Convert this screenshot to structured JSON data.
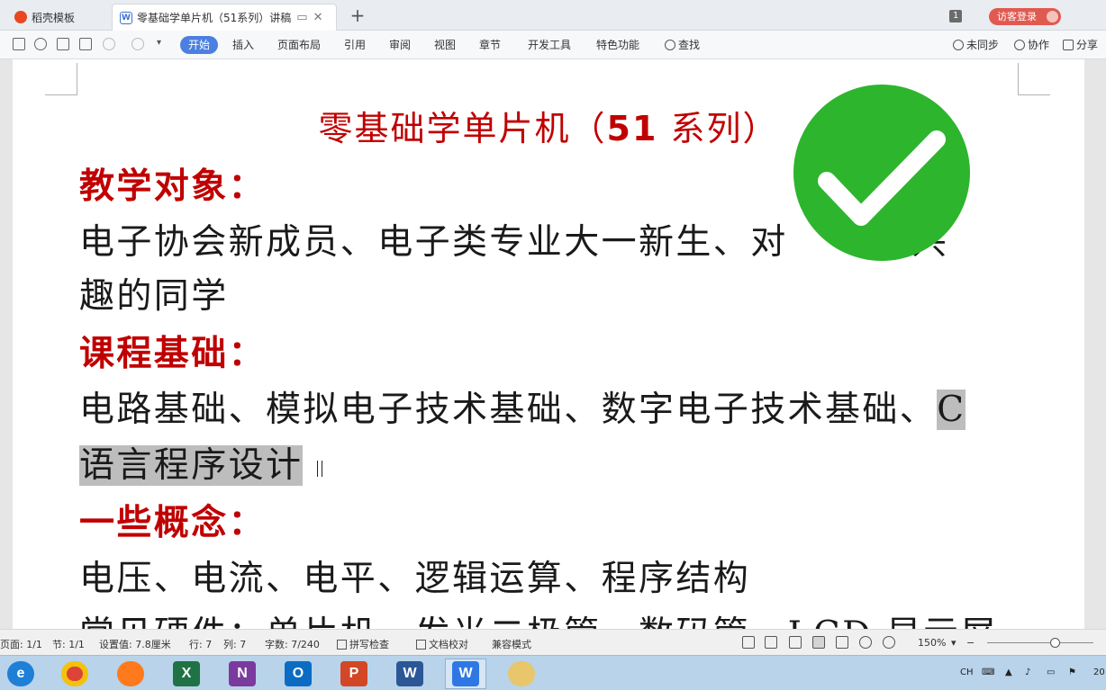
{
  "tabs": {
    "home_label": "稻壳模板",
    "doc_label": "零基础学单片机（51系列）讲稿",
    "new_tab": "+"
  },
  "header": {
    "page_count": "1",
    "login_label": "访客登录"
  },
  "ribbon": {
    "menu": [
      "开始",
      "插入",
      "页面布局",
      "引用",
      "审阅",
      "视图",
      "章节",
      "开发工具",
      "特色功能"
    ],
    "search_label": "查找",
    "sync_label": "未同步",
    "collab_label": "协作",
    "share_label": "分享"
  },
  "document": {
    "title_prefix": "零基础学单片机（",
    "title_number": "51",
    "title_suffix": " 系列）",
    "heading_1": "教学对象：",
    "body_1_line1": "电子协会新成员、电子类专业大一新生、对",
    "body_1_line1_tail": "感兴",
    "body_1_line2": "趣的同学",
    "heading_2": "课程基础：",
    "body_2_line1": "电路基础、模拟电子技术基础、数字电子技术基础、",
    "body_2_line1_sel": "C",
    "body_2_line2_sel": "语言程序设计",
    "heading_3": "一些概念：",
    "body_3": "电压、电流、电平、逻辑运算、程序结构",
    "body_4_partial": "常见硬件：单片机、发光二极管、数码管、LCD 显示屏"
  },
  "overlay": {
    "badge": "checkmark",
    "badge_color": "#2db52d"
  },
  "status": {
    "page": "页面: 1/1",
    "section": "节: 1/1",
    "setting": "设置值: 7.8厘米",
    "row": "行: 7",
    "col": "列: 7",
    "wordcount": "字数: 7/240",
    "spellcheck": "拼写检查",
    "proofread": "文档校对",
    "compat": "兼容模式",
    "zoom": "150%"
  },
  "taskbar": {
    "apps": [
      "ie-icon",
      "chrome-icon",
      "firefox-icon",
      "excel-icon",
      "onenote-icon",
      "outlook-icon",
      "powerpoint-icon",
      "word-icon",
      "wps-icon",
      "paint-icon"
    ],
    "tray_lang": "CH",
    "clock_partial": "20"
  },
  "colors": {
    "accent": "#4b7fe0",
    "heading_red": "#c00000",
    "login_red": "#e05a50"
  }
}
